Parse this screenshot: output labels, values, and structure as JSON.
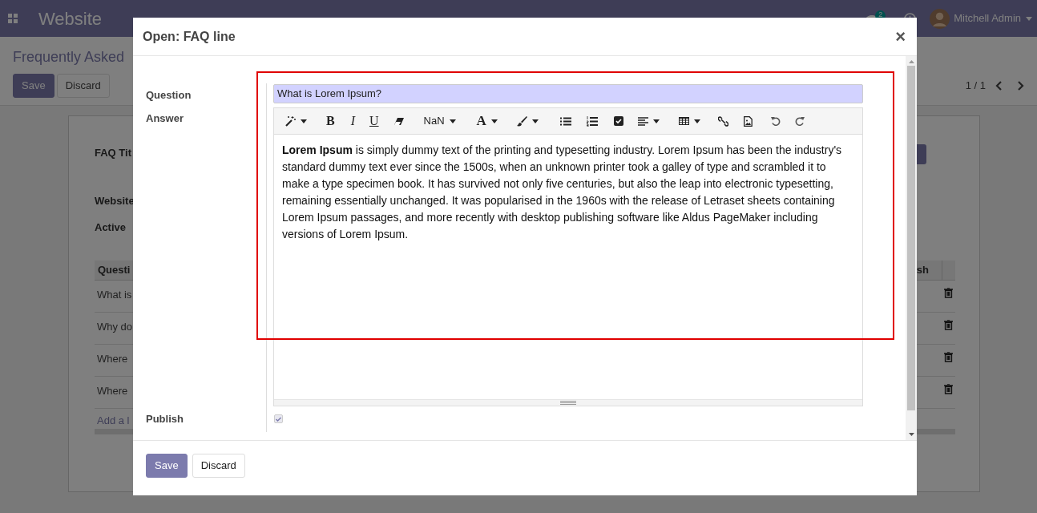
{
  "navbar": {
    "app_name": "Website",
    "notification_count": "2",
    "user": "Mitchell Admin"
  },
  "page": {
    "title": "Frequently Asked",
    "buttons": [
      {
        "label": "Save",
        "primary": true
      },
      {
        "label": "Discard",
        "primary": false
      }
    ],
    "pager": "1 / 1",
    "fields": [
      "FAQ Tit",
      "Website",
      "Active"
    ],
    "table": {
      "columns": [
        "Questi",
        "sh"
      ],
      "rows": [
        "What is",
        "Why do",
        "Where",
        "Where"
      ],
      "add_line": "Add a l"
    }
  },
  "dialog": {
    "title": "Open: FAQ line",
    "close": "×",
    "fields": [
      {
        "label": "Question",
        "kind": "input",
        "value": "What is Lorem Ipsum?"
      },
      {
        "label": "Answer",
        "kind": "editor",
        "toolbar": [
          {
            "kind": "magic",
            "dropdown": true
          },
          {
            "kind": "bold",
            "text": "B"
          },
          {
            "kind": "italic",
            "text": "I"
          },
          {
            "kind": "underline",
            "text": "U"
          },
          {
            "kind": "eraser"
          },
          {
            "kind": "fontsize",
            "text": "NaN",
            "dropdown": true
          },
          {
            "kind": "fontcolor",
            "text": "A",
            "dropdown": true
          },
          {
            "kind": "brush",
            "dropdown": true
          },
          {
            "kind": "bullets"
          },
          {
            "kind": "numbers"
          },
          {
            "kind": "checklist"
          },
          {
            "kind": "align",
            "dropdown": true
          },
          {
            "kind": "table",
            "dropdown": true
          },
          {
            "kind": "link"
          },
          {
            "kind": "image"
          },
          {
            "kind": "undo"
          },
          {
            "kind": "redo"
          }
        ],
        "content": "**Lorem Ipsum** is simply dummy text of the printing and typesetting industry. Lorem Ipsum has been the industry's standard dummy text ever since the 1500s, when an unknown printer took a galley of type and scrambled it to make a type specimen book. It has survived not only five centuries, but also the leap into electronic typesetting, remaining essentially unchanged. It was popularised in the 1960s with the release of Letraset sheets containing Lorem Ipsum passages, and more recently with desktop publishing software like Aldus PageMaker including versions of Lorem Ipsum."
      },
      {
        "label": "Publish",
        "kind": "checkbox",
        "checked": true
      }
    ],
    "buttons": [
      {
        "label": "Save",
        "primary": true
      },
      {
        "label": "Discard",
        "primary": false
      }
    ]
  }
}
